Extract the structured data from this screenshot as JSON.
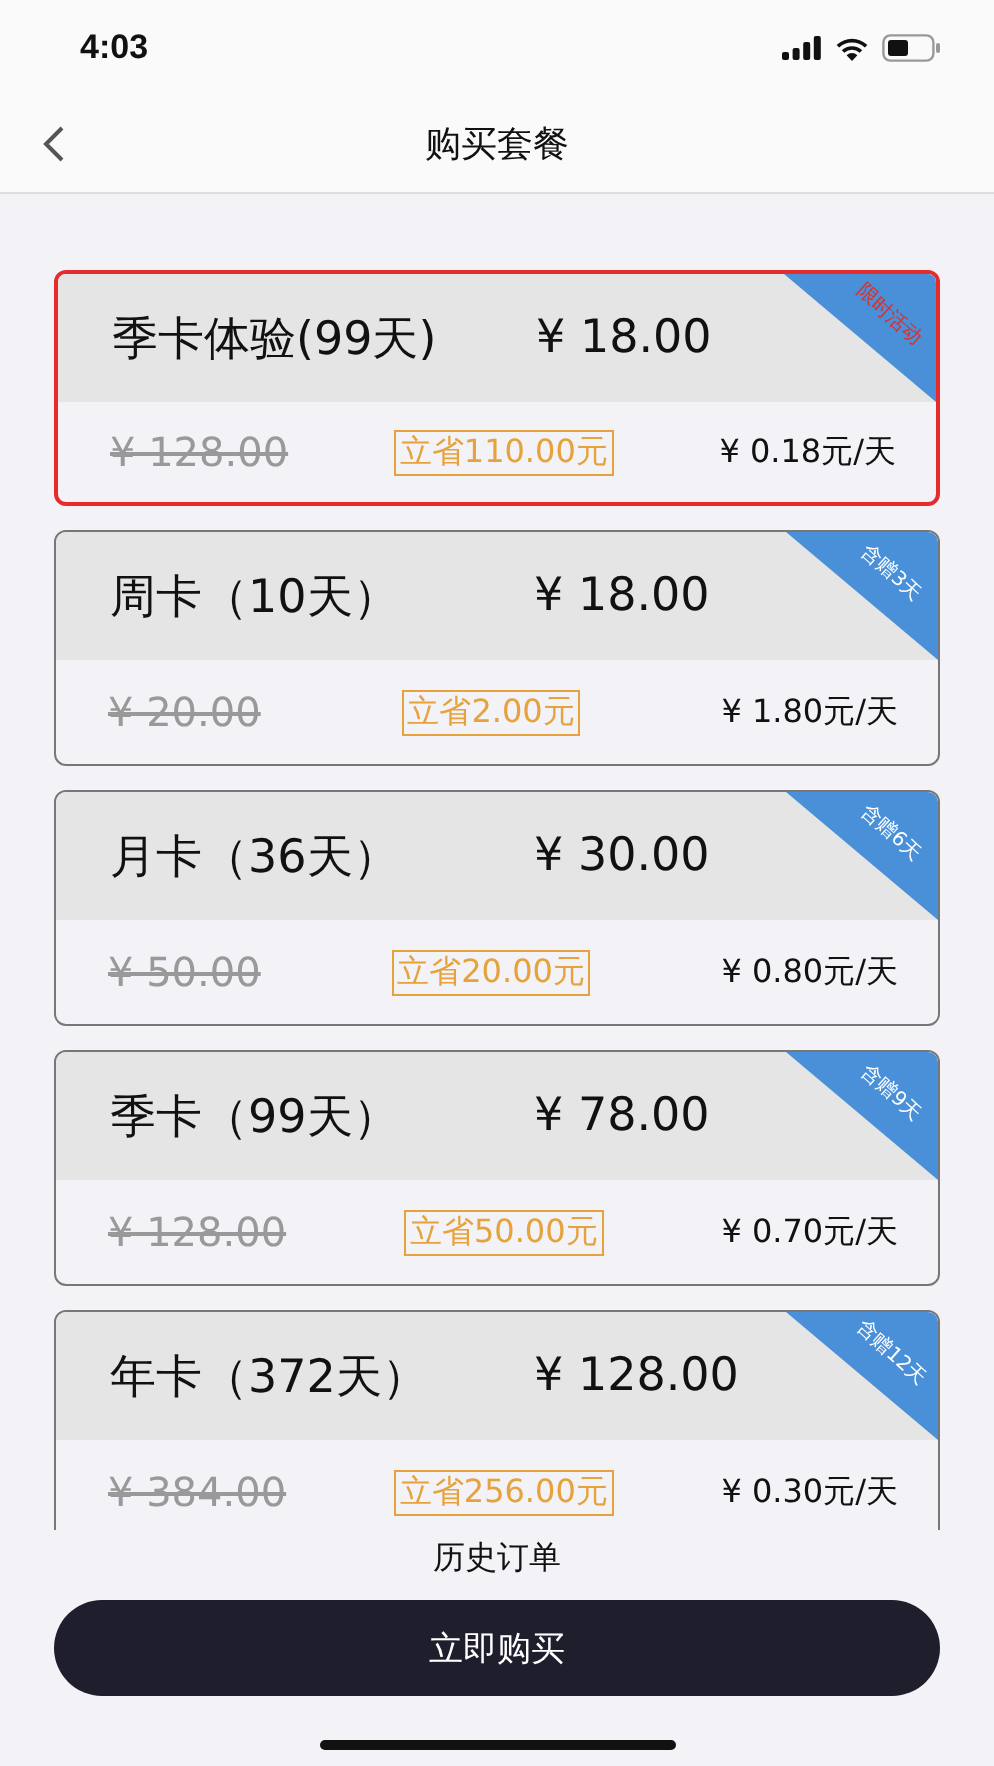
{
  "status_bar": {
    "time": "4:03"
  },
  "nav": {
    "title": "购买套餐"
  },
  "plans": [
    {
      "name": "季卡体验(99天)",
      "price": "¥ 18.00",
      "original_price": "¥ 128.00",
      "saving": "立省110.00元",
      "per_day": "¥ 0.18元/天",
      "ribbon": "限时活动",
      "selected": true
    },
    {
      "name": "周卡（10天）",
      "price": "¥ 18.00",
      "original_price": "¥ 20.00",
      "saving": "立省2.00元",
      "per_day": "¥ 1.80元/天",
      "ribbon": "含赠3天",
      "selected": false
    },
    {
      "name": "月卡（36天）",
      "price": "¥ 30.00",
      "original_price": "¥ 50.00",
      "saving": "立省20.00元",
      "per_day": "¥ 0.80元/天",
      "ribbon": "含赠6天",
      "selected": false
    },
    {
      "name": "季卡（99天）",
      "price": "¥ 78.00",
      "original_price": "¥ 128.00",
      "saving": "立省50.00元",
      "per_day": "¥ 0.70元/天",
      "ribbon": "含赠9天",
      "selected": false
    },
    {
      "name": "年卡（372天）",
      "price": "¥ 128.00",
      "original_price": "¥ 384.00",
      "saving": "立省256.00元",
      "per_day": "¥ 0.30元/天",
      "ribbon": "含赠12天",
      "selected": false
    }
  ],
  "history_link": "历史订单",
  "buy_button": "立即购买"
}
